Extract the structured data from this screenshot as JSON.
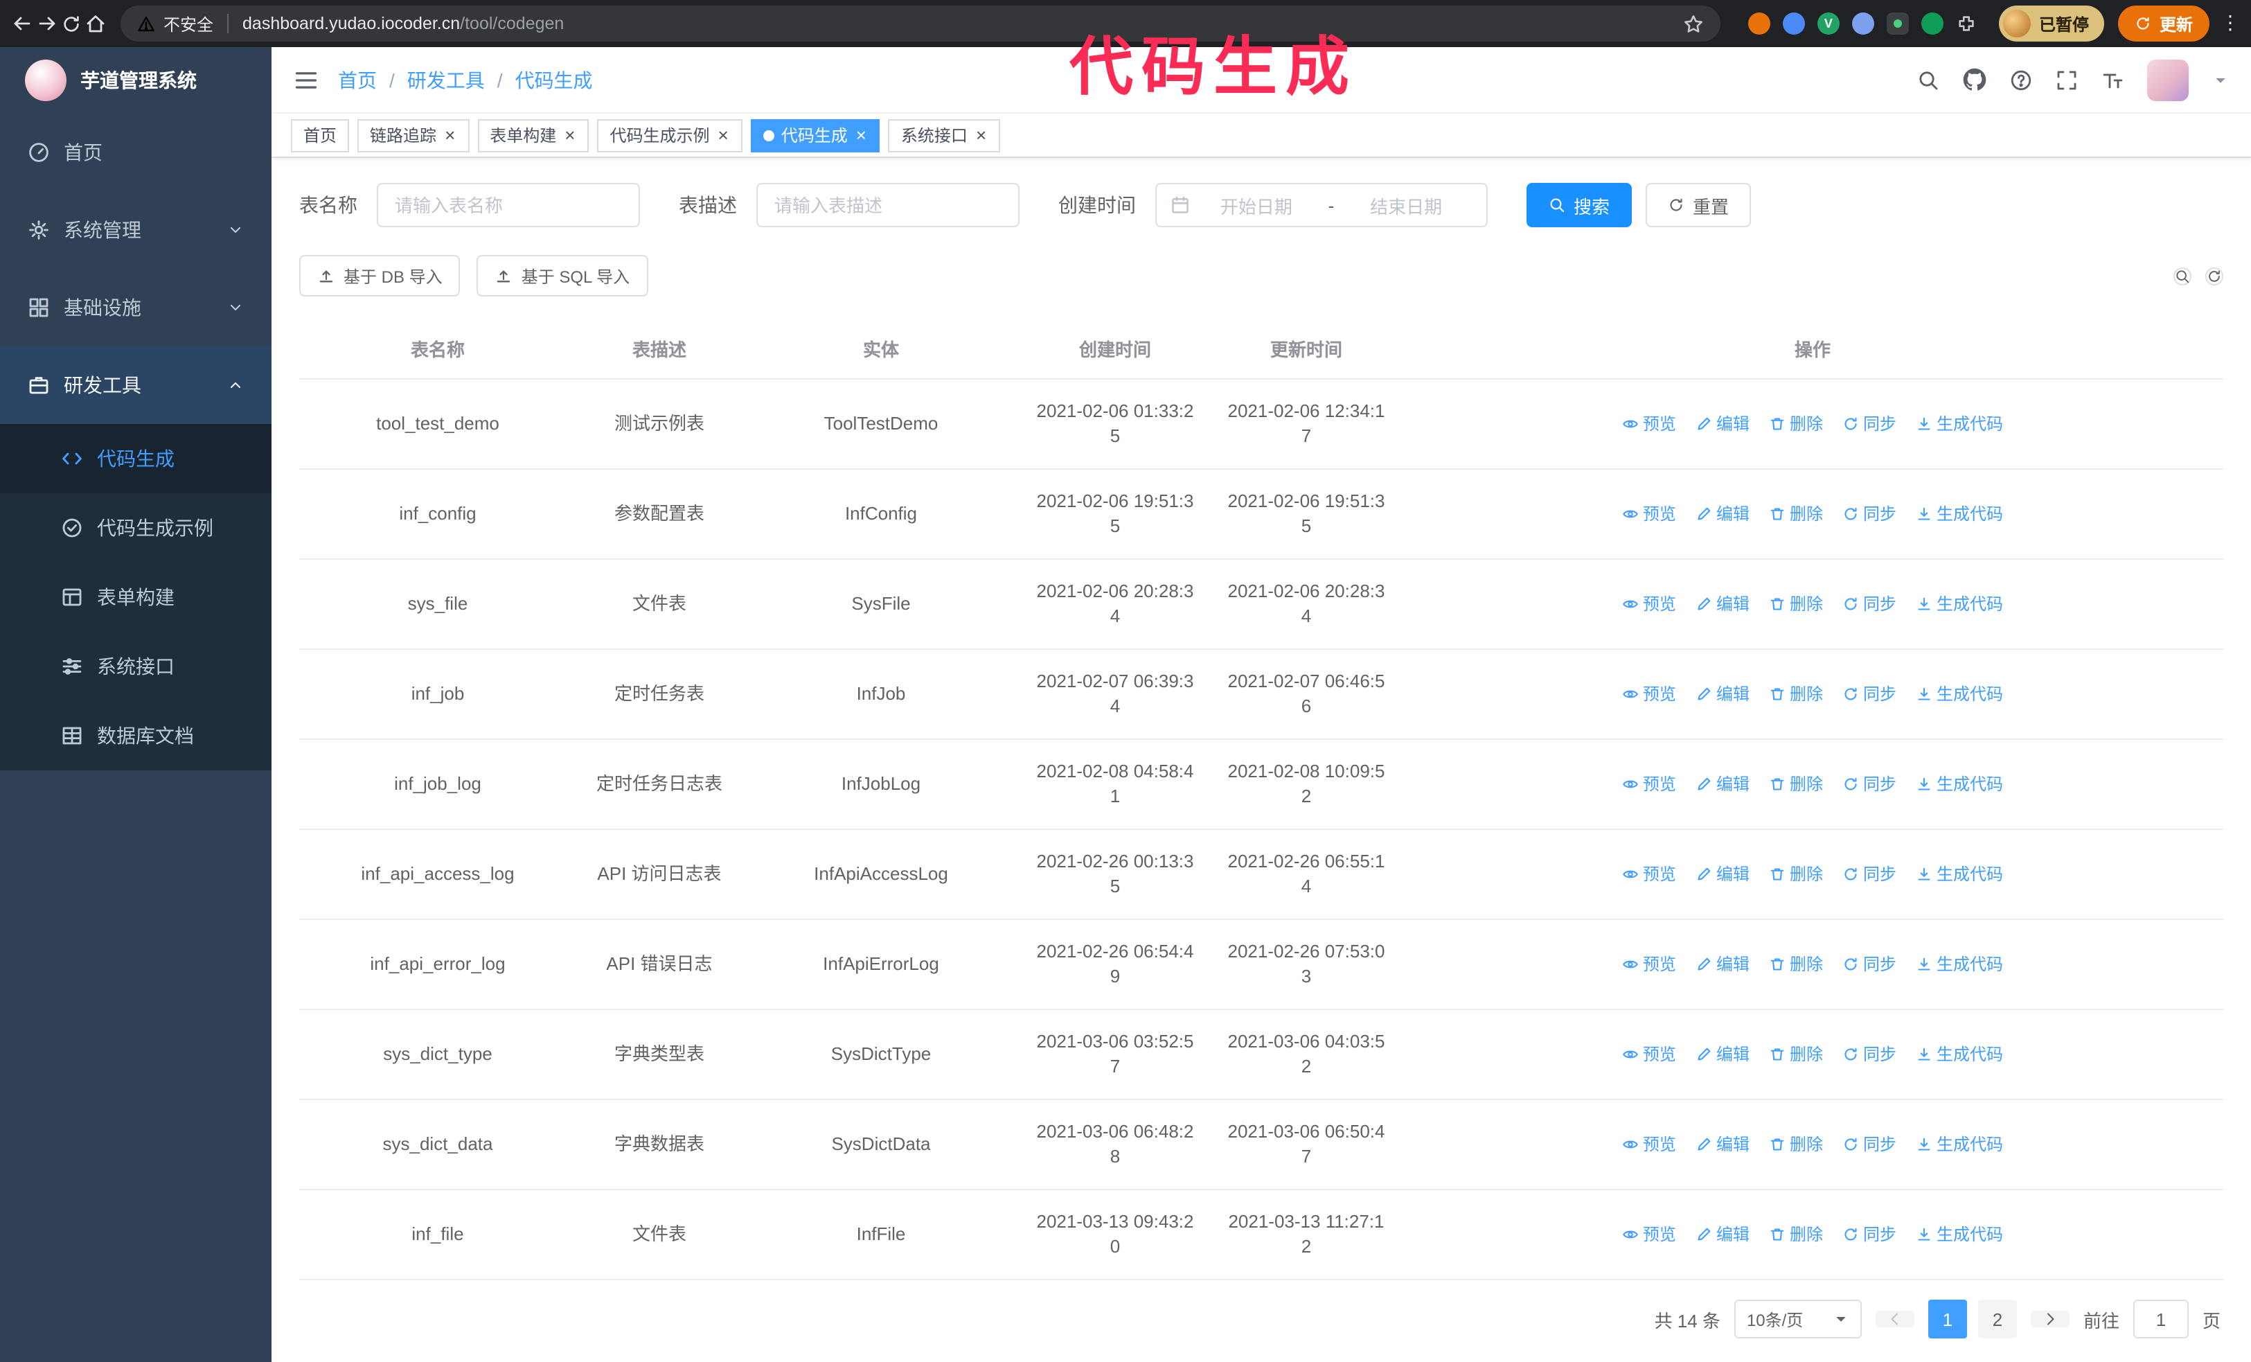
{
  "colors": {
    "accent": "#409eff",
    "primary_button": "#1890ff",
    "annotation": "#fa2c55",
    "sidebar_bg": "#304156",
    "sidebar_submenu_bg": "#1f2d3d",
    "chrome_bar": "#202124",
    "update_button": "#e8710a",
    "active_tag": "#409eff"
  },
  "annotation": {
    "text": "代码生成"
  },
  "browser": {
    "security_label": "不安全",
    "url_host": "dashboard.yudao.iocoder.cn",
    "url_path": "/tool/codegen",
    "profile_status": "已暂停",
    "update_label": "更新"
  },
  "sidebar": {
    "logo_title": "芋道管理系统",
    "items": [
      {
        "key": "home",
        "label": "首页",
        "icon": "home-icon",
        "type": "item"
      },
      {
        "key": "system",
        "label": "系统管理",
        "icon": "gear-icon",
        "type": "group",
        "expanded": false
      },
      {
        "key": "infra",
        "label": "基础设施",
        "icon": "infra-icon",
        "type": "group",
        "expanded": false
      },
      {
        "key": "devtools",
        "label": "研发工具",
        "icon": "tools-icon",
        "type": "group",
        "expanded": true,
        "active": true,
        "children": [
          {
            "key": "codegen",
            "label": "代码生成",
            "icon": "code-icon",
            "active": true
          },
          {
            "key": "codegen-example",
            "label": "代码生成示例",
            "icon": "example-icon"
          },
          {
            "key": "form-builder",
            "label": "表单构建",
            "icon": "form-icon"
          },
          {
            "key": "system-api",
            "label": "系统接口",
            "icon": "api-icon"
          },
          {
            "key": "db-doc",
            "label": "数据库文档",
            "icon": "dbdoc-icon"
          }
        ]
      }
    ]
  },
  "header": {
    "separator": "/",
    "breadcrumb": [
      "首页",
      "研发工具",
      "代码生成"
    ],
    "right_icons": [
      "search-icon",
      "github-icon",
      "question-icon",
      "fullscreen-icon",
      "font-size-icon",
      "user-avatar",
      "caret-down-icon"
    ]
  },
  "tags": [
    {
      "key": "home",
      "label": "首页",
      "closable": false,
      "active": false
    },
    {
      "key": "tracer",
      "label": "链路追踪",
      "closable": true,
      "active": false
    },
    {
      "key": "form-builder",
      "label": "表单构建",
      "closable": true,
      "active": false
    },
    {
      "key": "codegen-example",
      "label": "代码生成示例",
      "closable": true,
      "active": false
    },
    {
      "key": "codegen",
      "label": "代码生成",
      "closable": true,
      "active": true
    },
    {
      "key": "system-api",
      "label": "系统接口",
      "closable": true,
      "active": false
    }
  ],
  "search_form": {
    "fields": [
      {
        "label": "表名称",
        "placeholder": "请输入表名称"
      },
      {
        "label": "表描述",
        "placeholder": "请输入表描述"
      }
    ],
    "date_field": {
      "label": "创建时间",
      "start_placeholder": "开始日期",
      "separator": "-",
      "end_placeholder": "结束日期"
    },
    "search_label": "搜索",
    "reset_label": "重置"
  },
  "toolbar": {
    "import_db_label": "基于 DB 导入",
    "import_sql_label": "基于 SQL 导入"
  },
  "table": {
    "columns": [
      "表名称",
      "表描述",
      "实体",
      "创建时间",
      "更新时间",
      "操作"
    ],
    "ops": [
      {
        "key": "preview",
        "label": "预览",
        "icon": "eye-icon"
      },
      {
        "key": "edit",
        "label": "编辑",
        "icon": "edit-icon"
      },
      {
        "key": "delete",
        "label": "删除",
        "icon": "delete-icon"
      },
      {
        "key": "sync",
        "label": "同步",
        "icon": "sync-icon"
      },
      {
        "key": "generate",
        "label": "生成代码",
        "icon": "download-icon"
      }
    ],
    "rows": [
      {
        "name": "tool_test_demo",
        "desc": "测试示例表",
        "entity": "ToolTestDemo",
        "created": "2021-02-06 01:33:25",
        "updated": "2021-02-06 12:34:17"
      },
      {
        "name": "inf_config",
        "desc": "参数配置表",
        "entity": "InfConfig",
        "created": "2021-02-06 19:51:35",
        "updated": "2021-02-06 19:51:35"
      },
      {
        "name": "sys_file",
        "desc": "文件表",
        "entity": "SysFile",
        "created": "2021-02-06 20:28:34",
        "updated": "2021-02-06 20:28:34"
      },
      {
        "name": "inf_job",
        "desc": "定时任务表",
        "entity": "InfJob",
        "created": "2021-02-07 06:39:34",
        "updated": "2021-02-07 06:46:56"
      },
      {
        "name": "inf_job_log",
        "desc": "定时任务日志表",
        "entity": "InfJobLog",
        "created": "2021-02-08 04:58:41",
        "updated": "2021-02-08 10:09:52"
      },
      {
        "name": "inf_api_access_log",
        "desc": "API 访问日志表",
        "entity": "InfApiAccessLog",
        "created": "2021-02-26 00:13:35",
        "updated": "2021-02-26 06:55:14"
      },
      {
        "name": "inf_api_error_log",
        "desc": "API 错误日志",
        "entity": "InfApiErrorLog",
        "created": "2021-02-26 06:54:49",
        "updated": "2021-02-26 07:53:03"
      },
      {
        "name": "sys_dict_type",
        "desc": "字典类型表",
        "entity": "SysDictType",
        "created": "2021-03-06 03:52:57",
        "updated": "2021-03-06 04:03:52"
      },
      {
        "name": "sys_dict_data",
        "desc": "字典数据表",
        "entity": "SysDictData",
        "created": "2021-03-06 06:48:28",
        "updated": "2021-03-06 06:50:47"
      },
      {
        "name": "inf_file",
        "desc": "文件表",
        "entity": "InfFile",
        "created": "2021-03-13 09:43:20",
        "updated": "2021-03-13 11:27:12"
      }
    ]
  },
  "pagination": {
    "total_label": "共 14 条",
    "page_size": "10条/页",
    "pages": [
      "1",
      "2"
    ],
    "active_page": "1",
    "goto_label": "前往",
    "goto_value": "1",
    "goto_suffix": "页"
  }
}
